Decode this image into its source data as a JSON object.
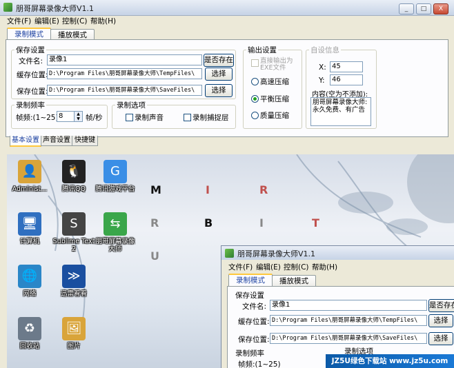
{
  "window": {
    "title": "朋哥屏幕录像大师V1.1",
    "controls": {
      "minimize": "_",
      "maximize": "□",
      "close": "X"
    }
  },
  "menu": [
    "文件(F)",
    "编辑(E)",
    "控制(C)",
    "帮助(H)"
  ],
  "tabs": [
    "录制模式",
    "播放模式"
  ],
  "save_settings": {
    "legend": "保存设置",
    "filename_label": "文件名:",
    "filename_value": "录像1",
    "exists_button": "是否存在",
    "cache_label": "缓存位置:",
    "cache_value": "D:\\Program Files\\朋哥屏幕录像大师\\TempFiles\\",
    "save_label": "保存位置:",
    "save_value": "D:\\Program Files\\朋哥屏幕录像大师\\SaveFiles\\",
    "choose_button": "选择"
  },
  "frame_rate": {
    "legend": "录制频率",
    "label": "帧频:(1~25)",
    "value": "8",
    "unit": "帧/秒"
  },
  "record_options": {
    "legend": "录制选项",
    "sound": "录制声音",
    "layered": "录制捕捉层"
  },
  "output": {
    "legend": "输出设置",
    "exe_option": "直接输出为EXE文件",
    "options": [
      "高速压缩",
      "平衡压缩",
      "质量压缩"
    ],
    "selected": "平衡压缩"
  },
  "custom_info": {
    "legend": "自设信息",
    "x_label": "X:",
    "x_value": "45",
    "y_label": "Y:",
    "y_value": "46",
    "content_label": "内容(空为不添加):",
    "content_value": "朋哥屏幕录像大师:永久免费、有广告"
  },
  "subtabs": [
    "基本设置",
    "声音设置",
    "快捷键"
  ],
  "desktop": {
    "icons": [
      {
        "label": "Administ...",
        "icon": "folder-user-icon",
        "color": "#d9a43a"
      },
      {
        "label": "腾讯QQ",
        "icon": "qq-penguin-icon",
        "color": "#222222"
      },
      {
        "label": "腾讯游戏平台",
        "icon": "tencent-games-icon",
        "color": "#3a8ee6"
      },
      {
        "label": "计算机",
        "icon": "computer-icon",
        "color": "#2f6fc0"
      },
      {
        "label": "Sublime Text 2",
        "icon": "sublime-text-icon",
        "color": "#444444"
      },
      {
        "label": "朋哥屏幕录像大师",
        "icon": "recorder-app-icon",
        "color": "#3aa64a"
      },
      {
        "label": "网络",
        "icon": "network-globe-icon",
        "color": "#2a86c8"
      },
      {
        "label": "迅雷看看",
        "icon": "xunlei-icon",
        "color": "#1a4fa0"
      },
      {
        "label": "回收站",
        "icon": "recycle-bin-icon",
        "color": "#6c7a8a"
      },
      {
        "label": "图片",
        "icon": "pictures-folder-icon",
        "color": "#d9a43a"
      }
    ],
    "letters": [
      "M",
      "I",
      "R",
      "R",
      "B",
      "I",
      "T",
      "U"
    ],
    "letter_colors": [
      "#111111",
      "#c0504d",
      "#c0504d",
      "#888888",
      "#111111",
      "#888888",
      "#c0504d",
      "#888888"
    ]
  },
  "watermark": "JZ5U绿色下载站 www.jz5u.com"
}
